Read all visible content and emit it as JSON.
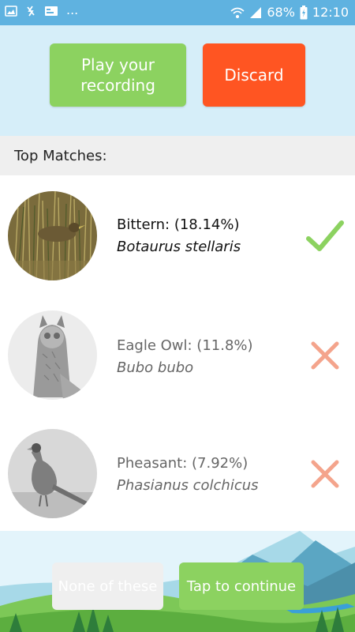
{
  "status_bar": {
    "battery": "68%",
    "time": "12:10",
    "more": "..."
  },
  "actions": {
    "play_line1": "Play your",
    "play_line2": "recording",
    "discard": "Discard"
  },
  "section_title": "Top Matches:",
  "matches": [
    {
      "common": "Bittern: (18.14%)",
      "scientific": "Botaurus stellaris",
      "status": "check",
      "selected": true
    },
    {
      "common": "Eagle Owl: (11.8%)",
      "scientific": "Bubo bubo",
      "status": "cross",
      "selected": false
    },
    {
      "common": "Pheasant: (7.92%)",
      "scientific": "Phasianus colchicus",
      "status": "cross",
      "selected": false
    }
  ],
  "footer": {
    "none": "None of these",
    "continue": "Tap to continue"
  },
  "colors": {
    "status_bar": "#5fb2e0",
    "green": "#8cd260",
    "orange": "#ff5522",
    "cross": "#f4a48c"
  }
}
